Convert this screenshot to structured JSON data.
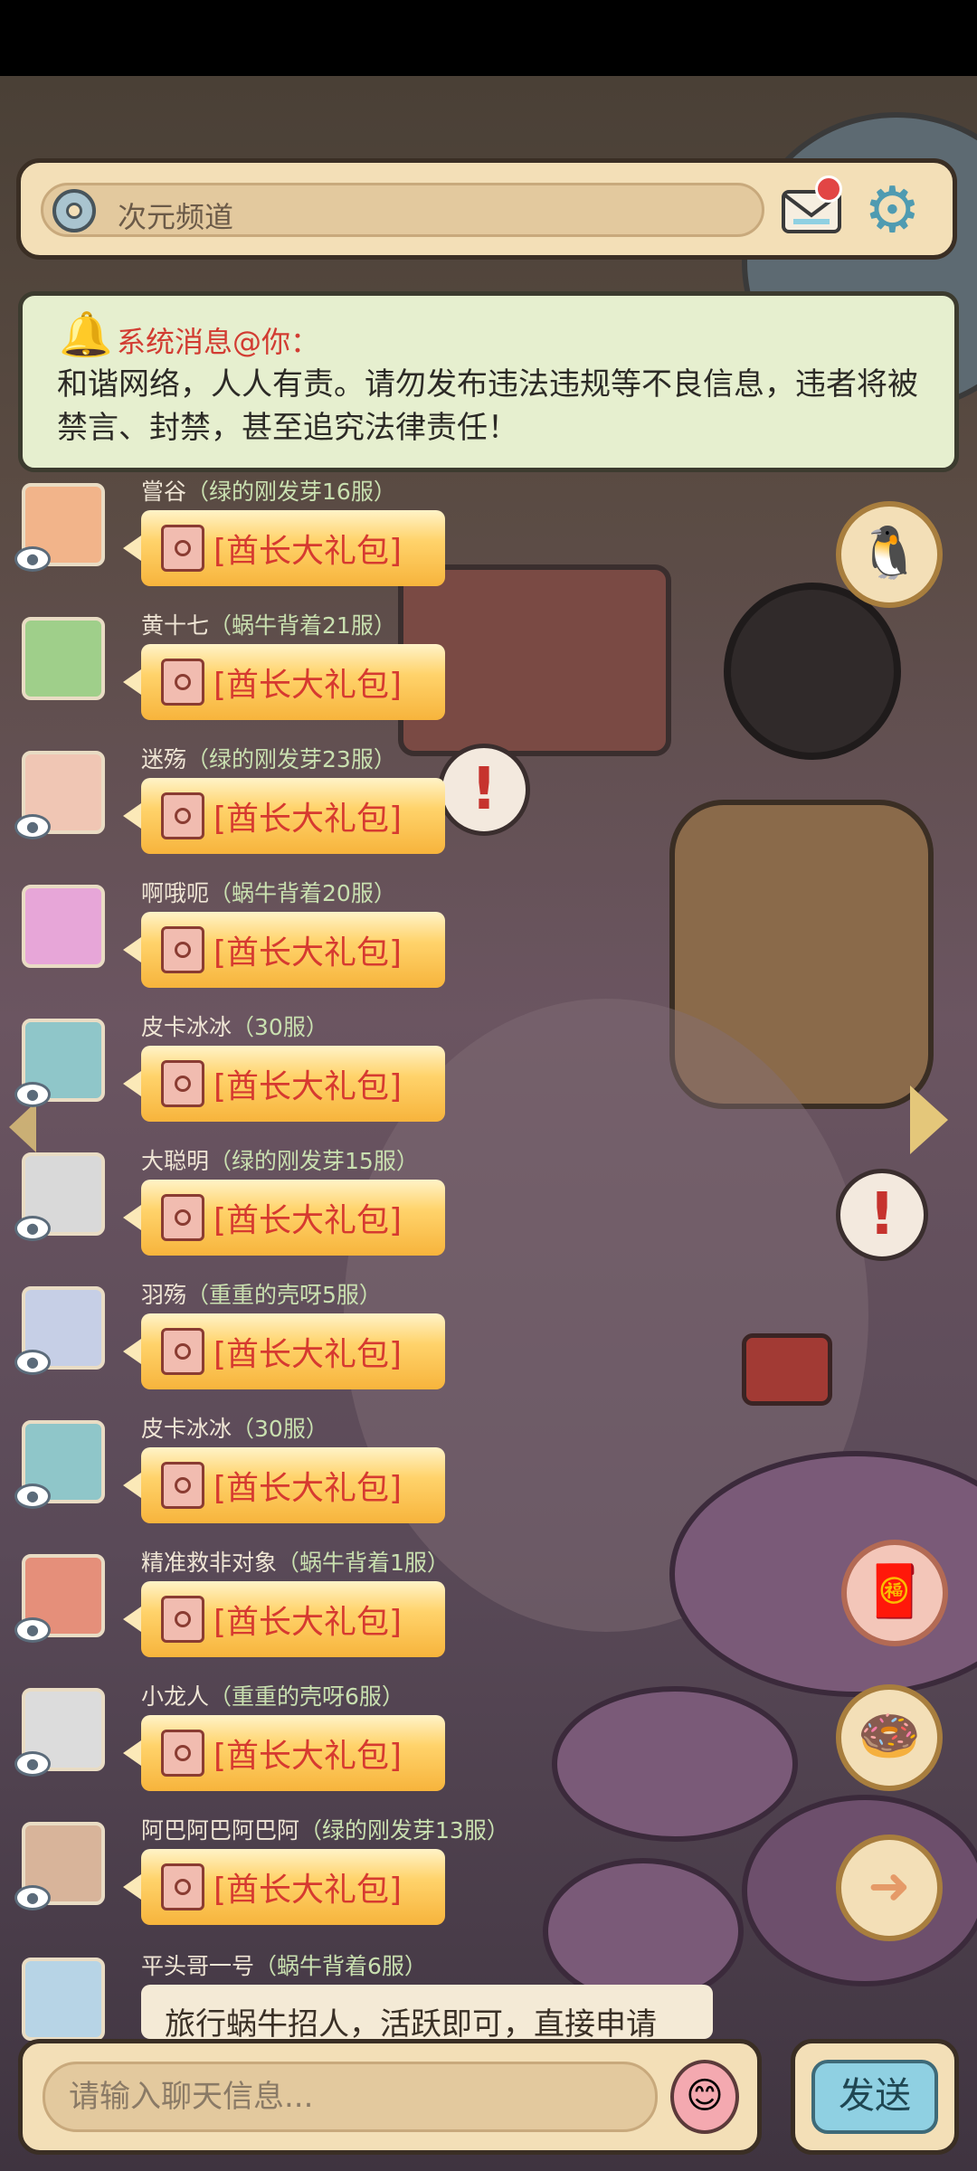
{
  "channel": {
    "name": "次元频道",
    "icon": "planet-icon"
  },
  "system_message": {
    "title": "系统消息@你：",
    "body": "和谐网络，人人有责。请勿发布违法违规等不良信息，违者将被禁言、封禁，甚至追究法律责任！"
  },
  "messages": [
    {
      "name": "嘗谷",
      "server": "（绿的刚发芽16服）",
      "content": "[酋长大礼包]",
      "avatar_color": "#f2b48a",
      "verified": true
    },
    {
      "name": "黄十七",
      "server": "（蜗牛背着21服）",
      "content": "[酋长大礼包]",
      "avatar_color": "#9fcf8a",
      "verified": false
    },
    {
      "name": "迷殇",
      "server": "（绿的刚发芽23服）",
      "content": "[酋长大礼包]",
      "avatar_color": "#f0c6b4",
      "verified": true
    },
    {
      "name": "啊哦呃",
      "server": "（蜗牛背着20服）",
      "content": "[酋长大礼包]",
      "avatar_color": "#e7a6d8",
      "verified": false
    },
    {
      "name": "皮卡冰冰",
      "server": "（30服）",
      "content": "[酋长大礼包]",
      "avatar_color": "#8fc6c9",
      "verified": true
    },
    {
      "name": "大聪明",
      "server": "（绿的刚发芽15服）",
      "content": "[酋长大礼包]",
      "avatar_color": "#d9d9d9",
      "verified": true
    },
    {
      "name": "羽殇",
      "server": "（重重的壳呀5服）",
      "content": "[酋长大礼包]",
      "avatar_color": "#c6cfe6",
      "verified": true
    },
    {
      "name": "皮卡冰冰",
      "server": "（30服）",
      "content": "[酋长大礼包]",
      "avatar_color": "#8fc6c9",
      "verified": true
    },
    {
      "name": "精准救非对象",
      "server": "（蜗牛背着1服）",
      "content": "[酋长大礼包]",
      "avatar_color": "#e58f7a",
      "verified": true
    },
    {
      "name": "小龙人",
      "server": "（重重的壳呀6服）",
      "content": "[酋长大礼包]",
      "avatar_color": "#dcdcdc",
      "verified": true
    },
    {
      "name": "阿巴阿巴阿巴阿",
      "server": "（绿的刚发芽13服）",
      "content": "[酋长大礼包]",
      "avatar_color": "#d8b49a",
      "verified": true
    }
  ],
  "last_message": {
    "name": "平头哥一号",
    "server": "（蜗牛背着6服）",
    "content": "旅行蜗牛招人，活跃即可，直接申请",
    "avatar_color": "#b7d4e6"
  },
  "side_buttons": [
    "penguin-icon",
    "red-packet-icon",
    "donut-icon",
    "arrow-right-icon"
  ],
  "input": {
    "placeholder": "请输入聊天信息..."
  },
  "send": {
    "label": "发送"
  },
  "colors": {
    "bubble": "#ffd36b",
    "gift_text": "#d63a30",
    "system_title": "#d23c32",
    "send_button": "#8fd0e2"
  }
}
